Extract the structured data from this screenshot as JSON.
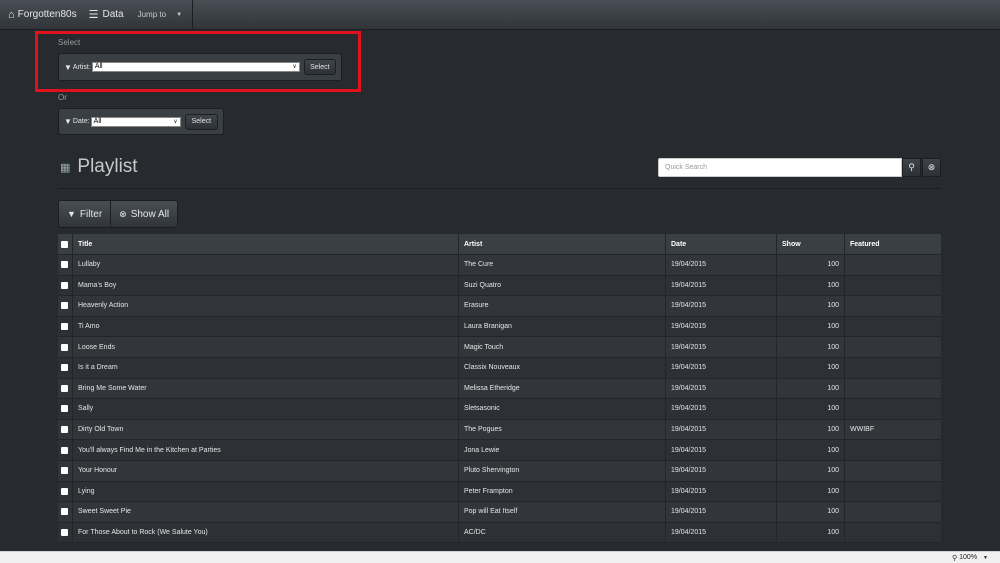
{
  "navbar": {
    "brand": "Forgotten80s",
    "data_link": "Data",
    "jump_to": "Jump to"
  },
  "select_section": {
    "heading": "Select",
    "artist_label": "Artist:",
    "artist_value": "All",
    "select_button": "Select",
    "or_label": "Or",
    "date_label": "Date:",
    "date_value": "All",
    "date_select_button": "Select"
  },
  "playlist": {
    "title": "Playlist",
    "search_placeholder": "Quick Search",
    "filter_button": "Filter",
    "show_all_button": "Show All",
    "columns": [
      "Title",
      "Artist",
      "Date",
      "Show",
      "Featured"
    ],
    "rows": [
      {
        "title": "Lullaby",
        "artist": "The Cure",
        "date": "19/04/2015",
        "show": "100",
        "featured": ""
      },
      {
        "title": "Mama's Boy",
        "artist": "Suzi Quatro",
        "date": "19/04/2015",
        "show": "100",
        "featured": ""
      },
      {
        "title": "Heavenly Action",
        "artist": "Erasure",
        "date": "19/04/2015",
        "show": "100",
        "featured": ""
      },
      {
        "title": "Ti Amo",
        "artist": "Laura Branigan",
        "date": "19/04/2015",
        "show": "100",
        "featured": ""
      },
      {
        "title": "Loose Ends",
        "artist": "Magic Touch",
        "date": "19/04/2015",
        "show": "100",
        "featured": ""
      },
      {
        "title": "Is it a Dream",
        "artist": "Classix Nouveaux",
        "date": "19/04/2015",
        "show": "100",
        "featured": ""
      },
      {
        "title": "Bring Me Some Water",
        "artist": "Melissa Etheridge",
        "date": "19/04/2015",
        "show": "100",
        "featured": ""
      },
      {
        "title": "Sally",
        "artist": "Sletsasonic",
        "date": "19/04/2015",
        "show": "100",
        "featured": ""
      },
      {
        "title": "Dirty Old Town",
        "artist": "The Pogues",
        "date": "19/04/2015",
        "show": "100",
        "featured": "WWIBF"
      },
      {
        "title": "You'll always Find Me in the Kitchen at Parties",
        "artist": "Jona Lewie",
        "date": "19/04/2015",
        "show": "100",
        "featured": ""
      },
      {
        "title": "Your Honour",
        "artist": "Pluto Shervington",
        "date": "19/04/2015",
        "show": "100",
        "featured": ""
      },
      {
        "title": "Lying",
        "artist": "Peter Frampton",
        "date": "19/04/2015",
        "show": "100",
        "featured": ""
      },
      {
        "title": "Sweet Sweet Pie",
        "artist": "Pop will Eat Itself",
        "date": "19/04/2015",
        "show": "100",
        "featured": ""
      },
      {
        "title": "For Those About to Rock (We Salute You)",
        "artist": "AC/DC",
        "date": "19/04/2015",
        "show": "100",
        "featured": ""
      }
    ]
  },
  "statusbar": {
    "zoom": "100%"
  },
  "icons": {
    "home": "home-icon",
    "list": "list-icon",
    "filter": "filter-icon",
    "search": "search-icon",
    "clear": "clear-icon",
    "playlist": "playlist-icon",
    "zoom": "zoom-icon"
  },
  "colors": {
    "background": "#272b30",
    "navbar": "#3a3f44",
    "highlight_box": "#e0131d"
  }
}
